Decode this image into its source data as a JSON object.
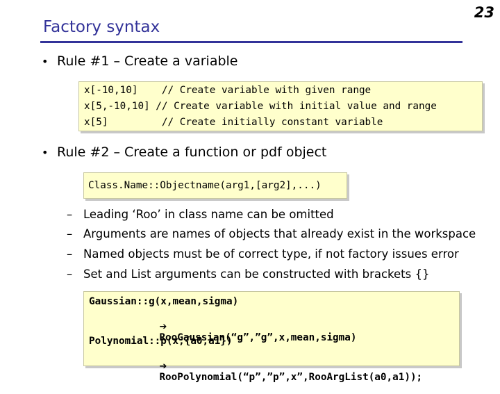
{
  "slide": {
    "title": "Factory syntax",
    "page_number": "23"
  },
  "rules": [
    {
      "bullet": "•",
      "text": "Rule #1 – Create a variable",
      "code_lines": [
        "x[-10,10]    // Create variable with given range",
        "x[5,-10,10] // Create variable with initial value and range",
        "x[5]         // Create initially constant variable"
      ]
    },
    {
      "bullet": "•",
      "text": "Rule #2 – Create a function or pdf object",
      "code_lines": [
        "Class.Name::Objectname(arg1,[arg2],...)"
      ]
    }
  ],
  "sub_bullets": [
    {
      "dash": "–",
      "text": "Leading ‘Roo’ in class name can be omitted"
    },
    {
      "dash": "–",
      "text": "Arguments are names of objects that already exist in the workspace"
    },
    {
      "dash": "–",
      "text": "Named objects must be of correct type, if not factory issues error"
    },
    {
      "dash": "–",
      "text": "Set and List arguments  can be constructed with brackets {}"
    }
  ],
  "examples": {
    "arrow_icon": "➔",
    "ex1_line1": "Gaussian::g(x,mean,sigma)",
    "ex1_line2": "RooGaussian(“g”,”g”,x,mean,sigma)",
    "ex2_line1": "Polynomial::p(x,{a0,a1})",
    "ex2_line2": "RooPolynomial(“p”,”p”,x”,RooArgList(a0,a1));"
  },
  "colors": {
    "title": "#333399",
    "code_box_bg": "#ffffcc"
  }
}
